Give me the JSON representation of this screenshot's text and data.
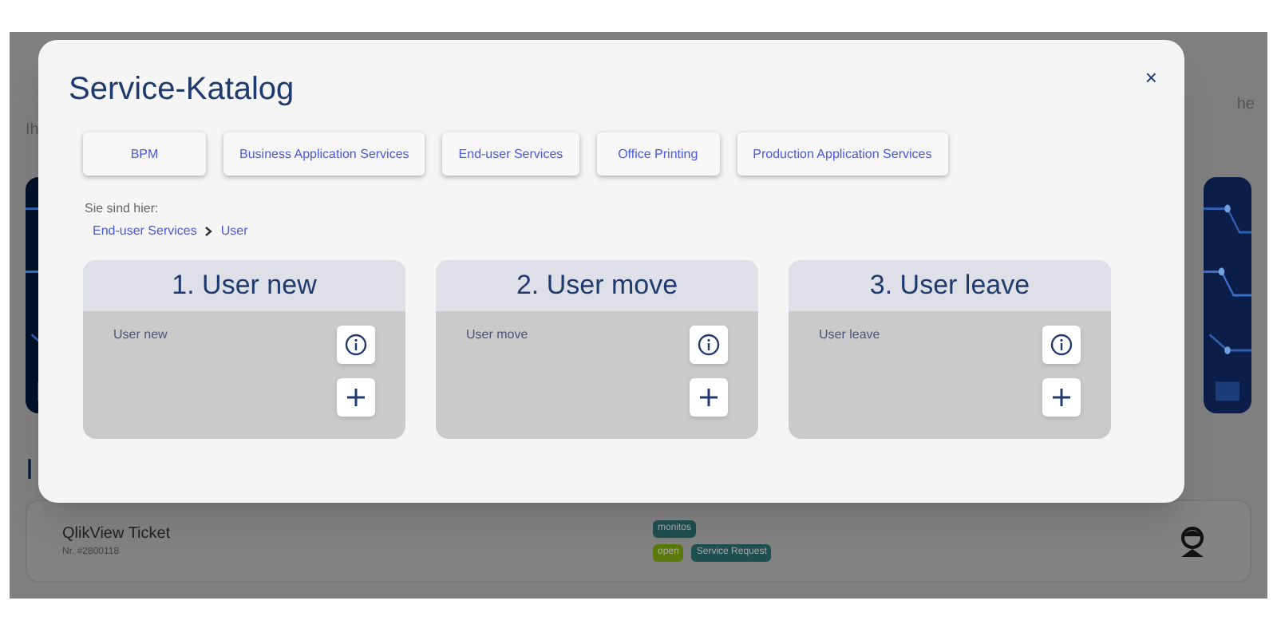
{
  "background": {
    "subtitle": "Ih",
    "side_text": "he",
    "section_heading": "I",
    "ticket": {
      "title": "QlikView Ticket",
      "number": "Nr. #2800118",
      "tag_rows": [
        [
          {
            "label": "monitos",
            "color": "#1f5052"
          }
        ],
        [
          {
            "label": "open",
            "color": "#5d7a0c"
          },
          {
            "label": "Service Request",
            "color": "#1f5052"
          }
        ]
      ]
    }
  },
  "modal": {
    "title": "Service-Katalog",
    "close": "×",
    "categories": [
      {
        "label": "BPM"
      },
      {
        "label": "Business Application Services"
      },
      {
        "label": "End-user Services"
      },
      {
        "label": "Office Printing"
      },
      {
        "label": "Production Application Services"
      }
    ],
    "breadcrumb": {
      "label": "Sie sind hier:",
      "path": [
        "End-user Services",
        "User"
      ]
    },
    "cards": [
      {
        "title": "1. User new",
        "description": "User new"
      },
      {
        "title": "2. User move",
        "description": "User move"
      },
      {
        "title": "3. User leave",
        "description": "User leave"
      }
    ]
  }
}
